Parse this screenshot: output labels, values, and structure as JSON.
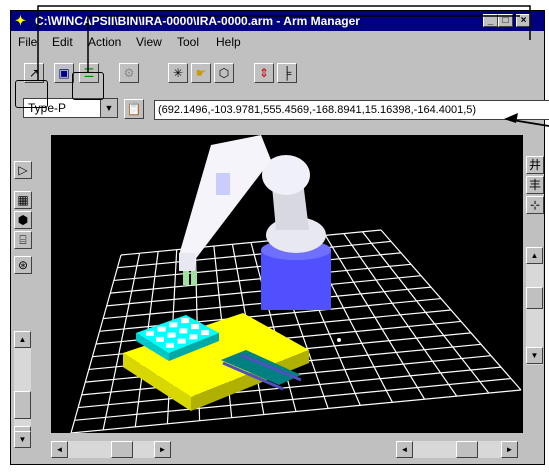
{
  "window": {
    "title": "C:\\WINCAPSII\\BIN\\IRA-0000\\IRA-0000.arm - Arm Manager",
    "controls": [
      "_",
      "□",
      "×"
    ]
  },
  "menu": {
    "file": "File",
    "edit": "Edit",
    "action": "Action",
    "view": "View",
    "tool": "Tool",
    "help": "Help"
  },
  "toolbar": {
    "type_select": {
      "value": "Type-P"
    },
    "coordinates": "(692.1496,-103.9781,555.4569,-168.8941,15.16398,-164.4001,5)"
  },
  "colors": {
    "title_bar": "#000080",
    "viewport_bg": "#000000",
    "grid": "#ffffff",
    "robot": "#e8e8f0",
    "base": "#5050ff",
    "table": "#ffff00",
    "tray": "#00ffff",
    "rail": "#008080"
  }
}
